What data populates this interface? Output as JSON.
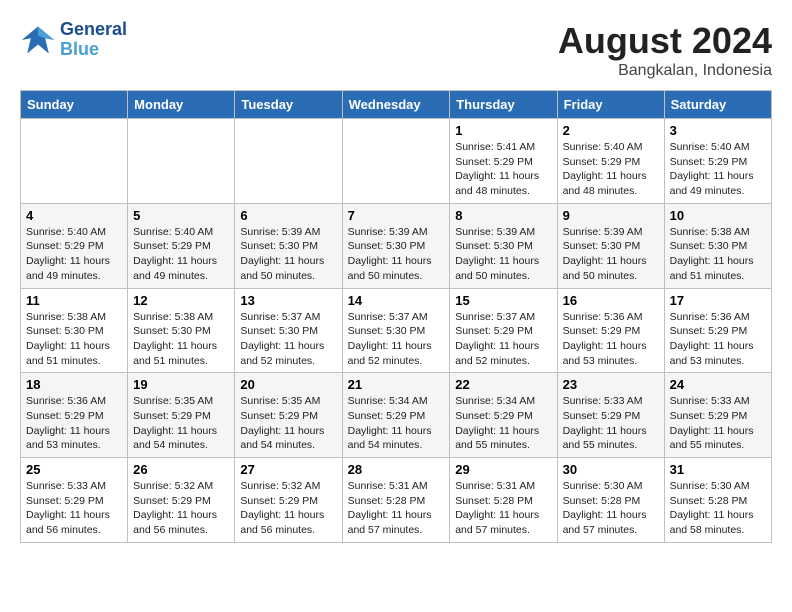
{
  "header": {
    "logo_line1": "General",
    "logo_line2": "Blue",
    "month": "August 2024",
    "location": "Bangkalan, Indonesia"
  },
  "days_of_week": [
    "Sunday",
    "Monday",
    "Tuesday",
    "Wednesday",
    "Thursday",
    "Friday",
    "Saturday"
  ],
  "weeks": [
    [
      {
        "day": "",
        "info": ""
      },
      {
        "day": "",
        "info": ""
      },
      {
        "day": "",
        "info": ""
      },
      {
        "day": "",
        "info": ""
      },
      {
        "day": "1",
        "info": "Sunrise: 5:41 AM\nSunset: 5:29 PM\nDaylight: 11 hours\nand 48 minutes."
      },
      {
        "day": "2",
        "info": "Sunrise: 5:40 AM\nSunset: 5:29 PM\nDaylight: 11 hours\nand 48 minutes."
      },
      {
        "day": "3",
        "info": "Sunrise: 5:40 AM\nSunset: 5:29 PM\nDaylight: 11 hours\nand 49 minutes."
      }
    ],
    [
      {
        "day": "4",
        "info": "Sunrise: 5:40 AM\nSunset: 5:29 PM\nDaylight: 11 hours\nand 49 minutes."
      },
      {
        "day": "5",
        "info": "Sunrise: 5:40 AM\nSunset: 5:29 PM\nDaylight: 11 hours\nand 49 minutes."
      },
      {
        "day": "6",
        "info": "Sunrise: 5:39 AM\nSunset: 5:30 PM\nDaylight: 11 hours\nand 50 minutes."
      },
      {
        "day": "7",
        "info": "Sunrise: 5:39 AM\nSunset: 5:30 PM\nDaylight: 11 hours\nand 50 minutes."
      },
      {
        "day": "8",
        "info": "Sunrise: 5:39 AM\nSunset: 5:30 PM\nDaylight: 11 hours\nand 50 minutes."
      },
      {
        "day": "9",
        "info": "Sunrise: 5:39 AM\nSunset: 5:30 PM\nDaylight: 11 hours\nand 50 minutes."
      },
      {
        "day": "10",
        "info": "Sunrise: 5:38 AM\nSunset: 5:30 PM\nDaylight: 11 hours\nand 51 minutes."
      }
    ],
    [
      {
        "day": "11",
        "info": "Sunrise: 5:38 AM\nSunset: 5:30 PM\nDaylight: 11 hours\nand 51 minutes."
      },
      {
        "day": "12",
        "info": "Sunrise: 5:38 AM\nSunset: 5:30 PM\nDaylight: 11 hours\nand 51 minutes."
      },
      {
        "day": "13",
        "info": "Sunrise: 5:37 AM\nSunset: 5:30 PM\nDaylight: 11 hours\nand 52 minutes."
      },
      {
        "day": "14",
        "info": "Sunrise: 5:37 AM\nSunset: 5:30 PM\nDaylight: 11 hours\nand 52 minutes."
      },
      {
        "day": "15",
        "info": "Sunrise: 5:37 AM\nSunset: 5:29 PM\nDaylight: 11 hours\nand 52 minutes."
      },
      {
        "day": "16",
        "info": "Sunrise: 5:36 AM\nSunset: 5:29 PM\nDaylight: 11 hours\nand 53 minutes."
      },
      {
        "day": "17",
        "info": "Sunrise: 5:36 AM\nSunset: 5:29 PM\nDaylight: 11 hours\nand 53 minutes."
      }
    ],
    [
      {
        "day": "18",
        "info": "Sunrise: 5:36 AM\nSunset: 5:29 PM\nDaylight: 11 hours\nand 53 minutes."
      },
      {
        "day": "19",
        "info": "Sunrise: 5:35 AM\nSunset: 5:29 PM\nDaylight: 11 hours\nand 54 minutes."
      },
      {
        "day": "20",
        "info": "Sunrise: 5:35 AM\nSunset: 5:29 PM\nDaylight: 11 hours\nand 54 minutes."
      },
      {
        "day": "21",
        "info": "Sunrise: 5:34 AM\nSunset: 5:29 PM\nDaylight: 11 hours\nand 54 minutes."
      },
      {
        "day": "22",
        "info": "Sunrise: 5:34 AM\nSunset: 5:29 PM\nDaylight: 11 hours\nand 55 minutes."
      },
      {
        "day": "23",
        "info": "Sunrise: 5:33 AM\nSunset: 5:29 PM\nDaylight: 11 hours\nand 55 minutes."
      },
      {
        "day": "24",
        "info": "Sunrise: 5:33 AM\nSunset: 5:29 PM\nDaylight: 11 hours\nand 55 minutes."
      }
    ],
    [
      {
        "day": "25",
        "info": "Sunrise: 5:33 AM\nSunset: 5:29 PM\nDaylight: 11 hours\nand 56 minutes."
      },
      {
        "day": "26",
        "info": "Sunrise: 5:32 AM\nSunset: 5:29 PM\nDaylight: 11 hours\nand 56 minutes."
      },
      {
        "day": "27",
        "info": "Sunrise: 5:32 AM\nSunset: 5:29 PM\nDaylight: 11 hours\nand 56 minutes."
      },
      {
        "day": "28",
        "info": "Sunrise: 5:31 AM\nSunset: 5:28 PM\nDaylight: 11 hours\nand 57 minutes."
      },
      {
        "day": "29",
        "info": "Sunrise: 5:31 AM\nSunset: 5:28 PM\nDaylight: 11 hours\nand 57 minutes."
      },
      {
        "day": "30",
        "info": "Sunrise: 5:30 AM\nSunset: 5:28 PM\nDaylight: 11 hours\nand 57 minutes."
      },
      {
        "day": "31",
        "info": "Sunrise: 5:30 AM\nSunset: 5:28 PM\nDaylight: 11 hours\nand 58 minutes."
      }
    ]
  ]
}
